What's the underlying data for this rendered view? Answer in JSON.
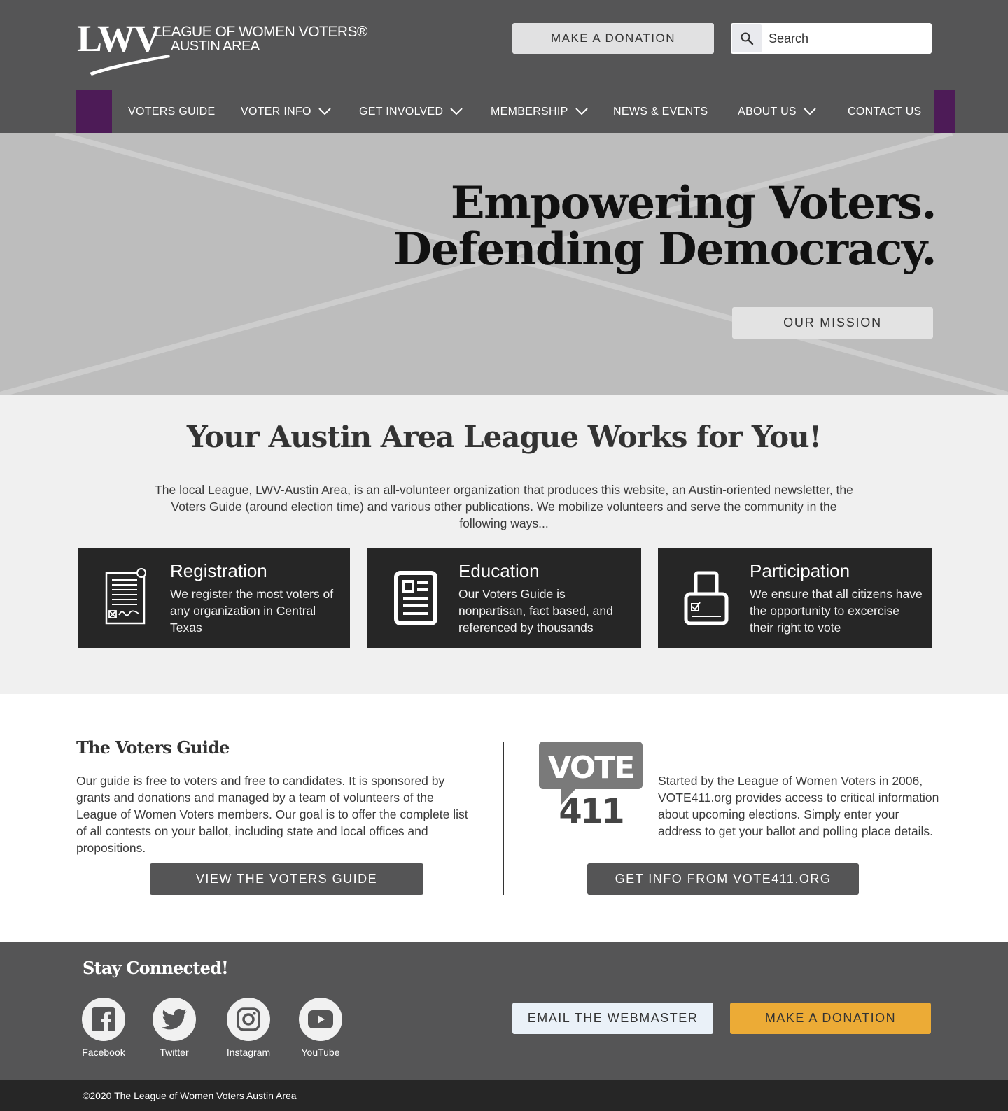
{
  "header": {
    "logo_mark": "LWV",
    "logo_line1": "LEAGUE OF WOMEN VOTERS®",
    "logo_line2": "AUSTIN AREA",
    "donate_label": "MAKE A DONATION",
    "search_placeholder": "Search",
    "search_icon": "search-icon"
  },
  "nav": {
    "items": [
      {
        "label": "VOTERS GUIDE",
        "has_dropdown": false
      },
      {
        "label": "VOTER INFO",
        "has_dropdown": true
      },
      {
        "label": "GET INVOLVED",
        "has_dropdown": true
      },
      {
        "label": "MEMBERSHIP",
        "has_dropdown": true
      },
      {
        "label": "NEWS & EVENTS",
        "has_dropdown": false
      },
      {
        "label": "ABOUT US",
        "has_dropdown": true
      },
      {
        "label": "CONTACT US",
        "has_dropdown": false
      }
    ],
    "accent_color": "#4d1b57"
  },
  "hero": {
    "title_line1": "Empowering Voters.",
    "title_line2": "Defending Democracy.",
    "mission_label": "OUR MISSION"
  },
  "works": {
    "title": "Your Austin Area League Works for You!",
    "text": "The local League, LWV-Austin Area, is an all-volunteer organization that produces this website, an Austin-oriented newsletter, the Voters Guide (around election time) and various other publications. We mobilize volunteers and serve the community in the following ways...",
    "cards": [
      {
        "title": "Registration",
        "text": "We register the most voters of any organization in Central Texas",
        "icon": "registration-form-icon"
      },
      {
        "title": "Education",
        "text": "Our Voters Guide is nonpartisan, fact based, and referenced by thousands",
        "icon": "newspaper-icon"
      },
      {
        "title": "Participation",
        "text": "We ensure that all citizens have the opportunity to excercise their right to vote",
        "icon": "ballot-box-icon"
      }
    ]
  },
  "guide": {
    "title": "The Voters Guide",
    "text": "Our guide is free to voters and free to candidates. It is sponsored by grants and donations and managed by a team of volunteers of the League of Women Voters members. Our goal is to offer the complete list of all contests on your ballot, including state and local offices and propositions.",
    "button_label": "VIEW THE VOTERS GUIDE",
    "vote411_logo_top": "VOTE",
    "vote411_logo_bottom": "411",
    "vote411_text": "Started by the League of Women Voters in 2006, VOTE411.org provides access to critical information about upcoming elections. Simply enter your address to get your ballot and polling place details.",
    "vote411_button_label": "GET INFO FROM VOTE411.ORG"
  },
  "footer": {
    "title": "Stay Connected!",
    "social": [
      {
        "label": "Facebook",
        "icon": "facebook-icon"
      },
      {
        "label": "Twitter",
        "icon": "twitter-icon"
      },
      {
        "label": "Instagram",
        "icon": "instagram-icon"
      },
      {
        "label": "YouTube",
        "icon": "youtube-icon"
      }
    ],
    "email_label": "EMAIL THE WEBMASTER",
    "donate_label": "MAKE A DONATION",
    "donate_color": "#ecab36",
    "copyright": "©2020 The League of Women Voters Austin Area"
  }
}
